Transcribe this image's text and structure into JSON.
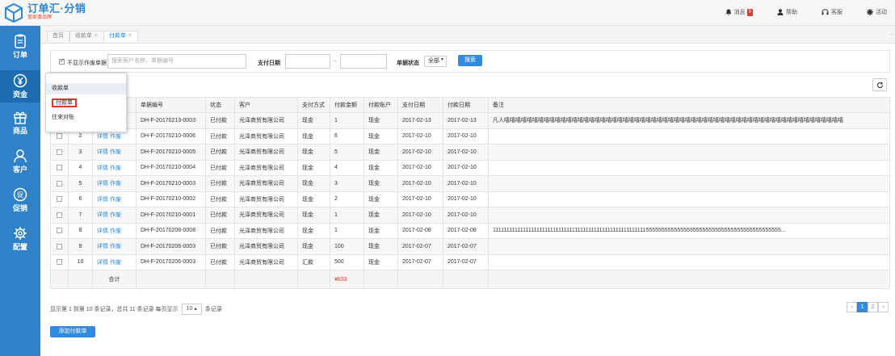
{
  "brand": {
    "title": "订单汇·分销",
    "subtitle": "管家婆品牌"
  },
  "header": {
    "messages_label": "消息",
    "messages_count": "9",
    "help_label": "帮助",
    "service_label": "客服",
    "settings_label": "活动"
  },
  "sidebar": {
    "items": [
      {
        "label": "订单",
        "icon": "clipboard-icon"
      },
      {
        "label": "资金",
        "icon": "yen-icon"
      },
      {
        "label": "商品",
        "icon": "gift-icon"
      },
      {
        "label": "客户",
        "icon": "user-icon"
      },
      {
        "label": "促销",
        "icon": "promo-icon"
      },
      {
        "label": "配置",
        "icon": "gear-icon"
      }
    ]
  },
  "tabs": [
    {
      "label": "首页",
      "closable": false
    },
    {
      "label": "收款单",
      "closable": true
    },
    {
      "label": "付款单",
      "closable": true,
      "active": true
    }
  ],
  "filter": {
    "hide_invalid_label": "不显示作废单据",
    "search_placeholder": "搜索客户名称，单据编号",
    "pay_date_label": "支付日期",
    "date_separator": "~",
    "status_label": "单据状态",
    "status_value": "全部",
    "search_button": "搜索"
  },
  "dropdown": {
    "items": [
      "收款单",
      "付款单",
      "往来对账"
    ]
  },
  "table": {
    "headers": [
      "",
      "",
      "",
      "单据编号",
      "状态",
      "客户",
      "支付方式",
      "付款金额",
      "付款账户",
      "支付日期",
      "付款日期",
      "备注"
    ],
    "action_detail": "详情",
    "action_void": "作废",
    "rows": [
      {
        "idx": "1",
        "no": "DH-F-20170213-0003",
        "status": "已付款",
        "customer": "光泽商贸有限公司",
        "method": "现金",
        "amount": "1",
        "account": "现金",
        "pay_date": "2017-02-13",
        "paid_date": "2017-02-13",
        "note": "凡人嘻嘻嘻嘻嘻嘻嘻嘻嘻嘻嘻嘻嘻嘻嘻嘻嘻嘻嘻嘻嘻嘻嘻嘻嘻嘻嘻嘻嘻嘻嘻嘻嘻嘻嘻嘻嘻嘻嘻嘻嘻嘻嘻嘻嘻嘻嘻嘻嘻嘻嘻嘻嘻嘻嘻嘻嘻嘻嘻嘻"
      },
      {
        "idx": "2",
        "no": "DH-F-20170210-0006",
        "status": "已付款",
        "customer": "光泽商贸有限公司",
        "method": "现金",
        "amount": "6",
        "account": "现金",
        "pay_date": "2017-02-10",
        "paid_date": "2017-02-10",
        "note": ""
      },
      {
        "idx": "3",
        "no": "DH-F-20170210-0005",
        "status": "已付款",
        "customer": "光泽商贸有限公司",
        "method": "现金",
        "amount": "5",
        "account": "现金",
        "pay_date": "2017-02-10",
        "paid_date": "2017-02-10",
        "note": ""
      },
      {
        "idx": "4",
        "no": "DH-F-20170210-0004",
        "status": "已付款",
        "customer": "光泽商贸有限公司",
        "method": "现金",
        "amount": "4",
        "account": "现金",
        "pay_date": "2017-02-10",
        "paid_date": "2017-02-10",
        "note": ""
      },
      {
        "idx": "5",
        "no": "DH-F-20170210-0003",
        "status": "已付款",
        "customer": "光泽商贸有限公司",
        "method": "现金",
        "amount": "3",
        "account": "现金",
        "pay_date": "2017-02-10",
        "paid_date": "2017-02-10",
        "note": ""
      },
      {
        "idx": "6",
        "no": "DH-F-20170210-0002",
        "status": "已付款",
        "customer": "光泽商贸有限公司",
        "method": "现金",
        "amount": "2",
        "account": "现金",
        "pay_date": "2017-02-10",
        "paid_date": "2017-02-10",
        "note": ""
      },
      {
        "idx": "7",
        "no": "DH-F-20170210-0001",
        "status": "已付款",
        "customer": "光泽商贸有限公司",
        "method": "现金",
        "amount": "1",
        "account": "现金",
        "pay_date": "2017-02-10",
        "paid_date": "2017-02-10",
        "note": ""
      },
      {
        "idx": "8",
        "no": "DH-F-20170208-0008",
        "status": "已付款",
        "customer": "光泽商贸有限公司",
        "method": "现金",
        "amount": "1",
        "account": "现金",
        "pay_date": "2017-02-08",
        "paid_date": "2017-02-08",
        "note": "111111111111111111111111111111111111111111111111111111115555555555555555555555555555555555555555555..."
      },
      {
        "idx": "9",
        "no": "DH-F-20170206-0003",
        "status": "已付款",
        "customer": "光泽商贸有限公司",
        "method": "现金",
        "amount": "100",
        "account": "现金",
        "pay_date": "2017-02-07",
        "paid_date": "2017-02-07",
        "note": ""
      },
      {
        "idx": "10",
        "no": "DH-F-20170206-0003",
        "status": "已付款",
        "customer": "光泽商贸有限公司",
        "method": "汇款",
        "amount": "500",
        "account": "现金",
        "pay_date": "2017-02-07",
        "paid_date": "2017-02-07",
        "note": ""
      }
    ],
    "total_label": "合计",
    "total_value": "¥633"
  },
  "pagination": {
    "info_prefix": "显示第 1 到第 10 条记录，总共 11 条记录 每页显示",
    "page_size": "10",
    "info_suffix": "条记录",
    "prev": "‹",
    "pages": [
      "1",
      "2"
    ],
    "next": "›"
  },
  "add_button": "添加付款单",
  "colors": {
    "primary": "#2f82c8",
    "accent": "#2f8ae0",
    "danger": "#e0352b"
  }
}
